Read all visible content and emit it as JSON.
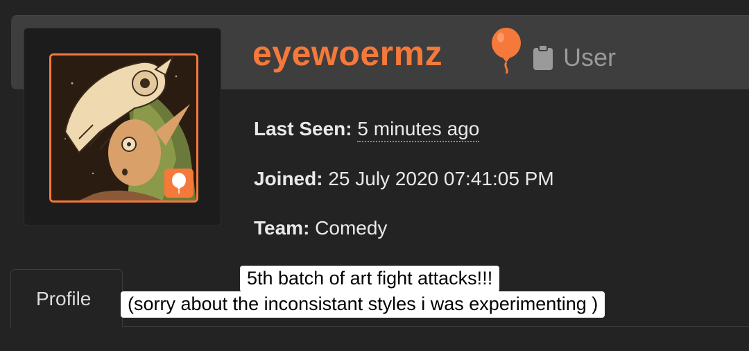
{
  "profile": {
    "username": "eyewoermz",
    "role": "User",
    "last_seen_label": "Last Seen:",
    "last_seen_value": "5 minutes ago",
    "joined_label": "Joined:",
    "joined_value": "25 July 2020 07:41:05 PM",
    "team_label": "Team:",
    "team_value": "Comedy"
  },
  "tabs": {
    "active": "Profile"
  },
  "caption": {
    "line1": "5th batch of art fight attacks!!!",
    "line2": "(sorry about the inconsistant styles i was experimenting )"
  },
  "colors": {
    "accent": "#f5793a",
    "background": "#232323",
    "header": "#3e3e3e",
    "muted_text": "#9a9a9a"
  },
  "icons": {
    "team_icon": "balloon-icon",
    "role_icon": "clipboard-icon",
    "avatar_badge": "balloon-icon"
  }
}
